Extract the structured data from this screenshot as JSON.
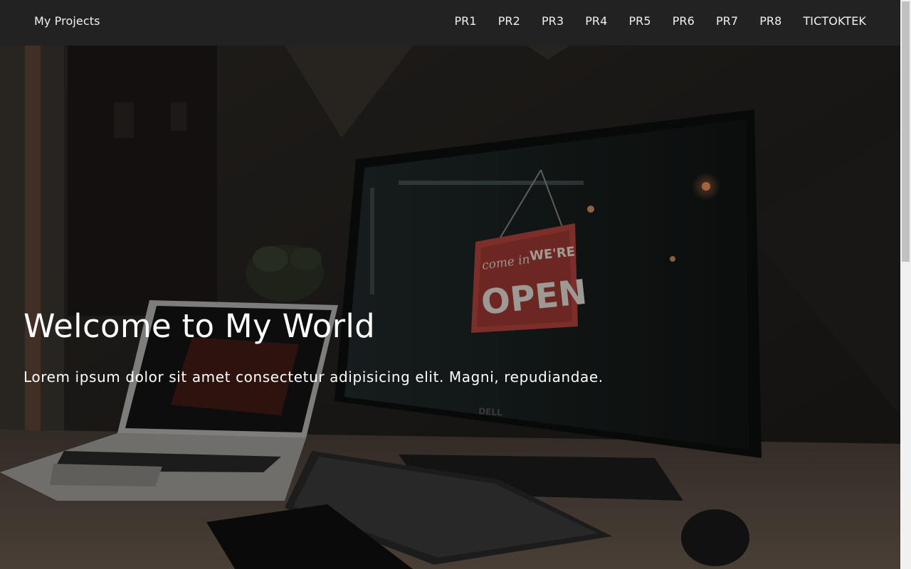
{
  "navbar": {
    "brand": "My Projects",
    "links": [
      "PR1",
      "PR2",
      "PR3",
      "PR4",
      "PR5",
      "PR6",
      "PR7",
      "PR8",
      "TICTOKTEK"
    ]
  },
  "hero": {
    "title": "Welcome to My World",
    "subtitle": "Lorem ipsum dolor sit amet consectetur adipisicing elit. Magni, repudiandae.",
    "background_photo": {
      "sign_line1_script": "come in",
      "sign_line1_caps": "WE'RE",
      "sign_line2": "OPEN",
      "monitor_brand": "DELL"
    }
  },
  "colors": {
    "navbar_bg": "#222222",
    "nav_text": "#f1f1f1",
    "hero_text": "#ffffff",
    "sign_red": "#b8453e"
  }
}
